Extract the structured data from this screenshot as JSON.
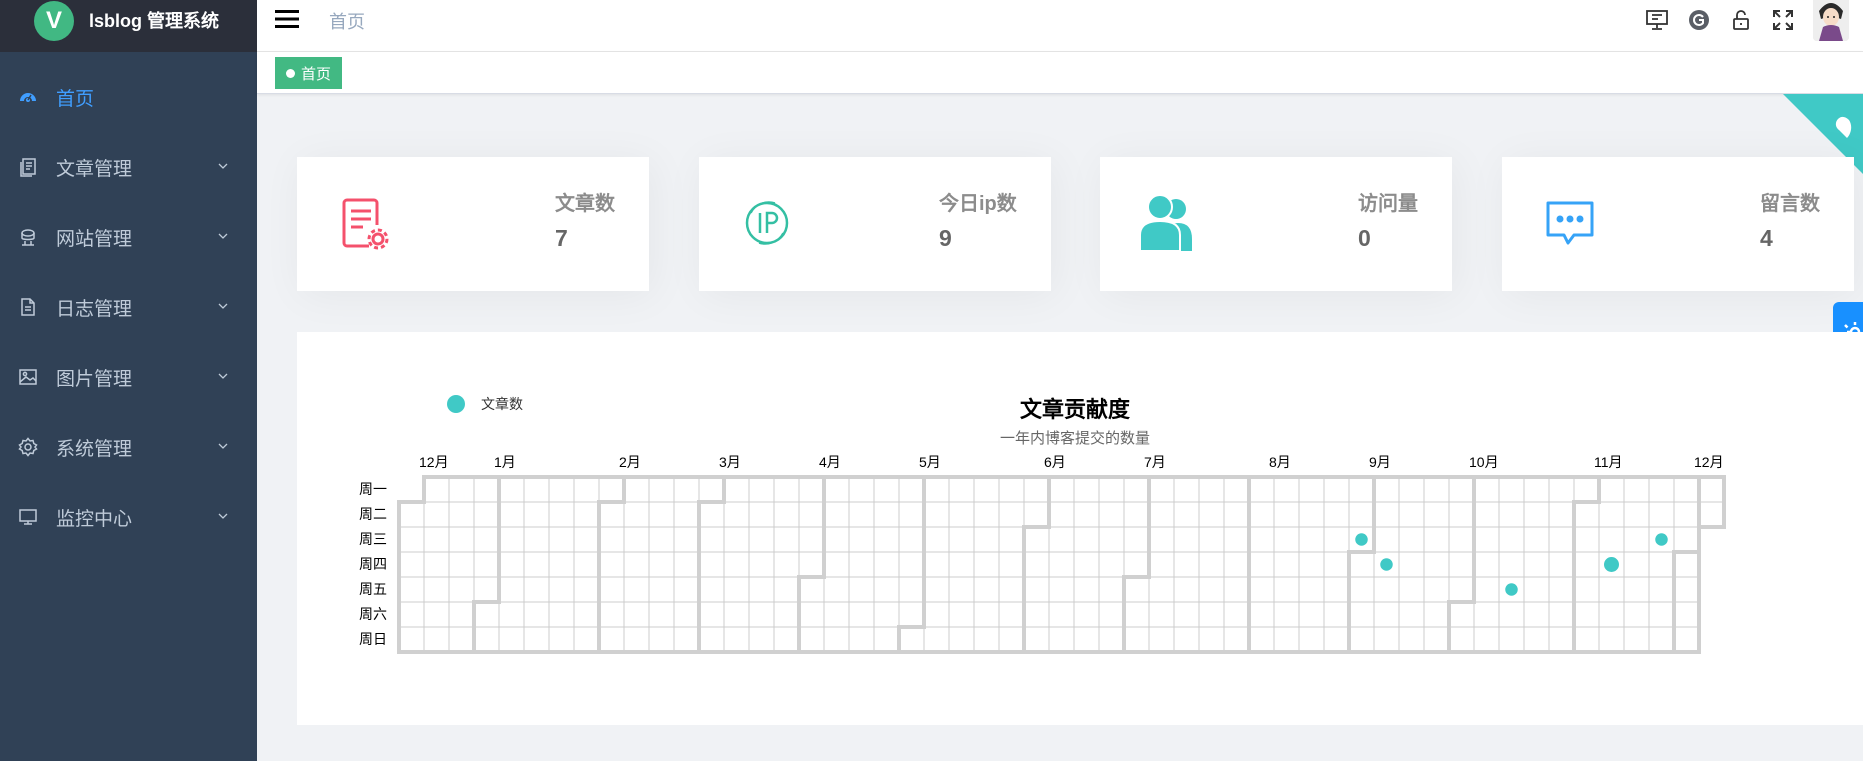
{
  "app": {
    "logo_letter": "V",
    "title": "lsblog 管理系统"
  },
  "sidebar": {
    "items": [
      {
        "label": "首页",
        "icon": "dashboard-icon",
        "active": true
      },
      {
        "label": "文章管理",
        "icon": "article-icon"
      },
      {
        "label": "网站管理",
        "icon": "website-icon"
      },
      {
        "label": "日志管理",
        "icon": "log-icon"
      },
      {
        "label": "图片管理",
        "icon": "image-icon"
      },
      {
        "label": "系统管理",
        "icon": "settings-icon"
      },
      {
        "label": "监控中心",
        "icon": "monitor-icon"
      }
    ]
  },
  "navbar": {
    "breadcrumb": "首页",
    "icons": [
      "monitor-icon",
      "github-icon",
      "lock-icon",
      "fullscreen-icon",
      "avatar"
    ]
  },
  "tags": {
    "active": "首页"
  },
  "cards": [
    {
      "title": "文章数",
      "value": "7",
      "icon": "article-settings-icon",
      "color": "#f4516c"
    },
    {
      "title": "今日ip数",
      "value": "9",
      "icon": "ip-icon",
      "color": "#34bfa3"
    },
    {
      "title": "访问量",
      "value": "0",
      "icon": "users-icon",
      "color": "#40c9c6"
    },
    {
      "title": "留言数",
      "value": "4",
      "icon": "message-icon",
      "color": "#36a3f7"
    }
  ],
  "chart": {
    "title": "文章贡献度",
    "subtitle": "一年内博客提交的数量"
  },
  "chart_data": {
    "type": "heatmap",
    "title": "文章贡献度",
    "subtitle": "一年内博客提交的数量",
    "legend": [
      {
        "name": "文章数",
        "color": "#40c9c6"
      }
    ],
    "legend_position": "top-left",
    "month_labels": [
      "12月",
      "1月",
      "2月",
      "3月",
      "4月",
      "5月",
      "6月",
      "7月",
      "8月",
      "9月",
      "10月",
      "11月",
      "12月"
    ],
    "weekday_labels": [
      "周一",
      "周二",
      "周三",
      "周四",
      "周五",
      "周六",
      "周日"
    ],
    "range": [
      "2021-12-07",
      "2022-12-06"
    ],
    "points": [
      {
        "date": "2022-08-31",
        "value": 1
      },
      {
        "date": "2022-09-08",
        "value": 1
      },
      {
        "date": "2022-10-14",
        "value": 1
      },
      {
        "date": "2022-11-10",
        "value": 2
      },
      {
        "date": "2022-11-23",
        "value": 1
      }
    ]
  },
  "colors": {
    "sidebar_bg": "#304156",
    "accent": "#409eff",
    "tag_green": "#42b983",
    "dot": "#40c9c6"
  }
}
